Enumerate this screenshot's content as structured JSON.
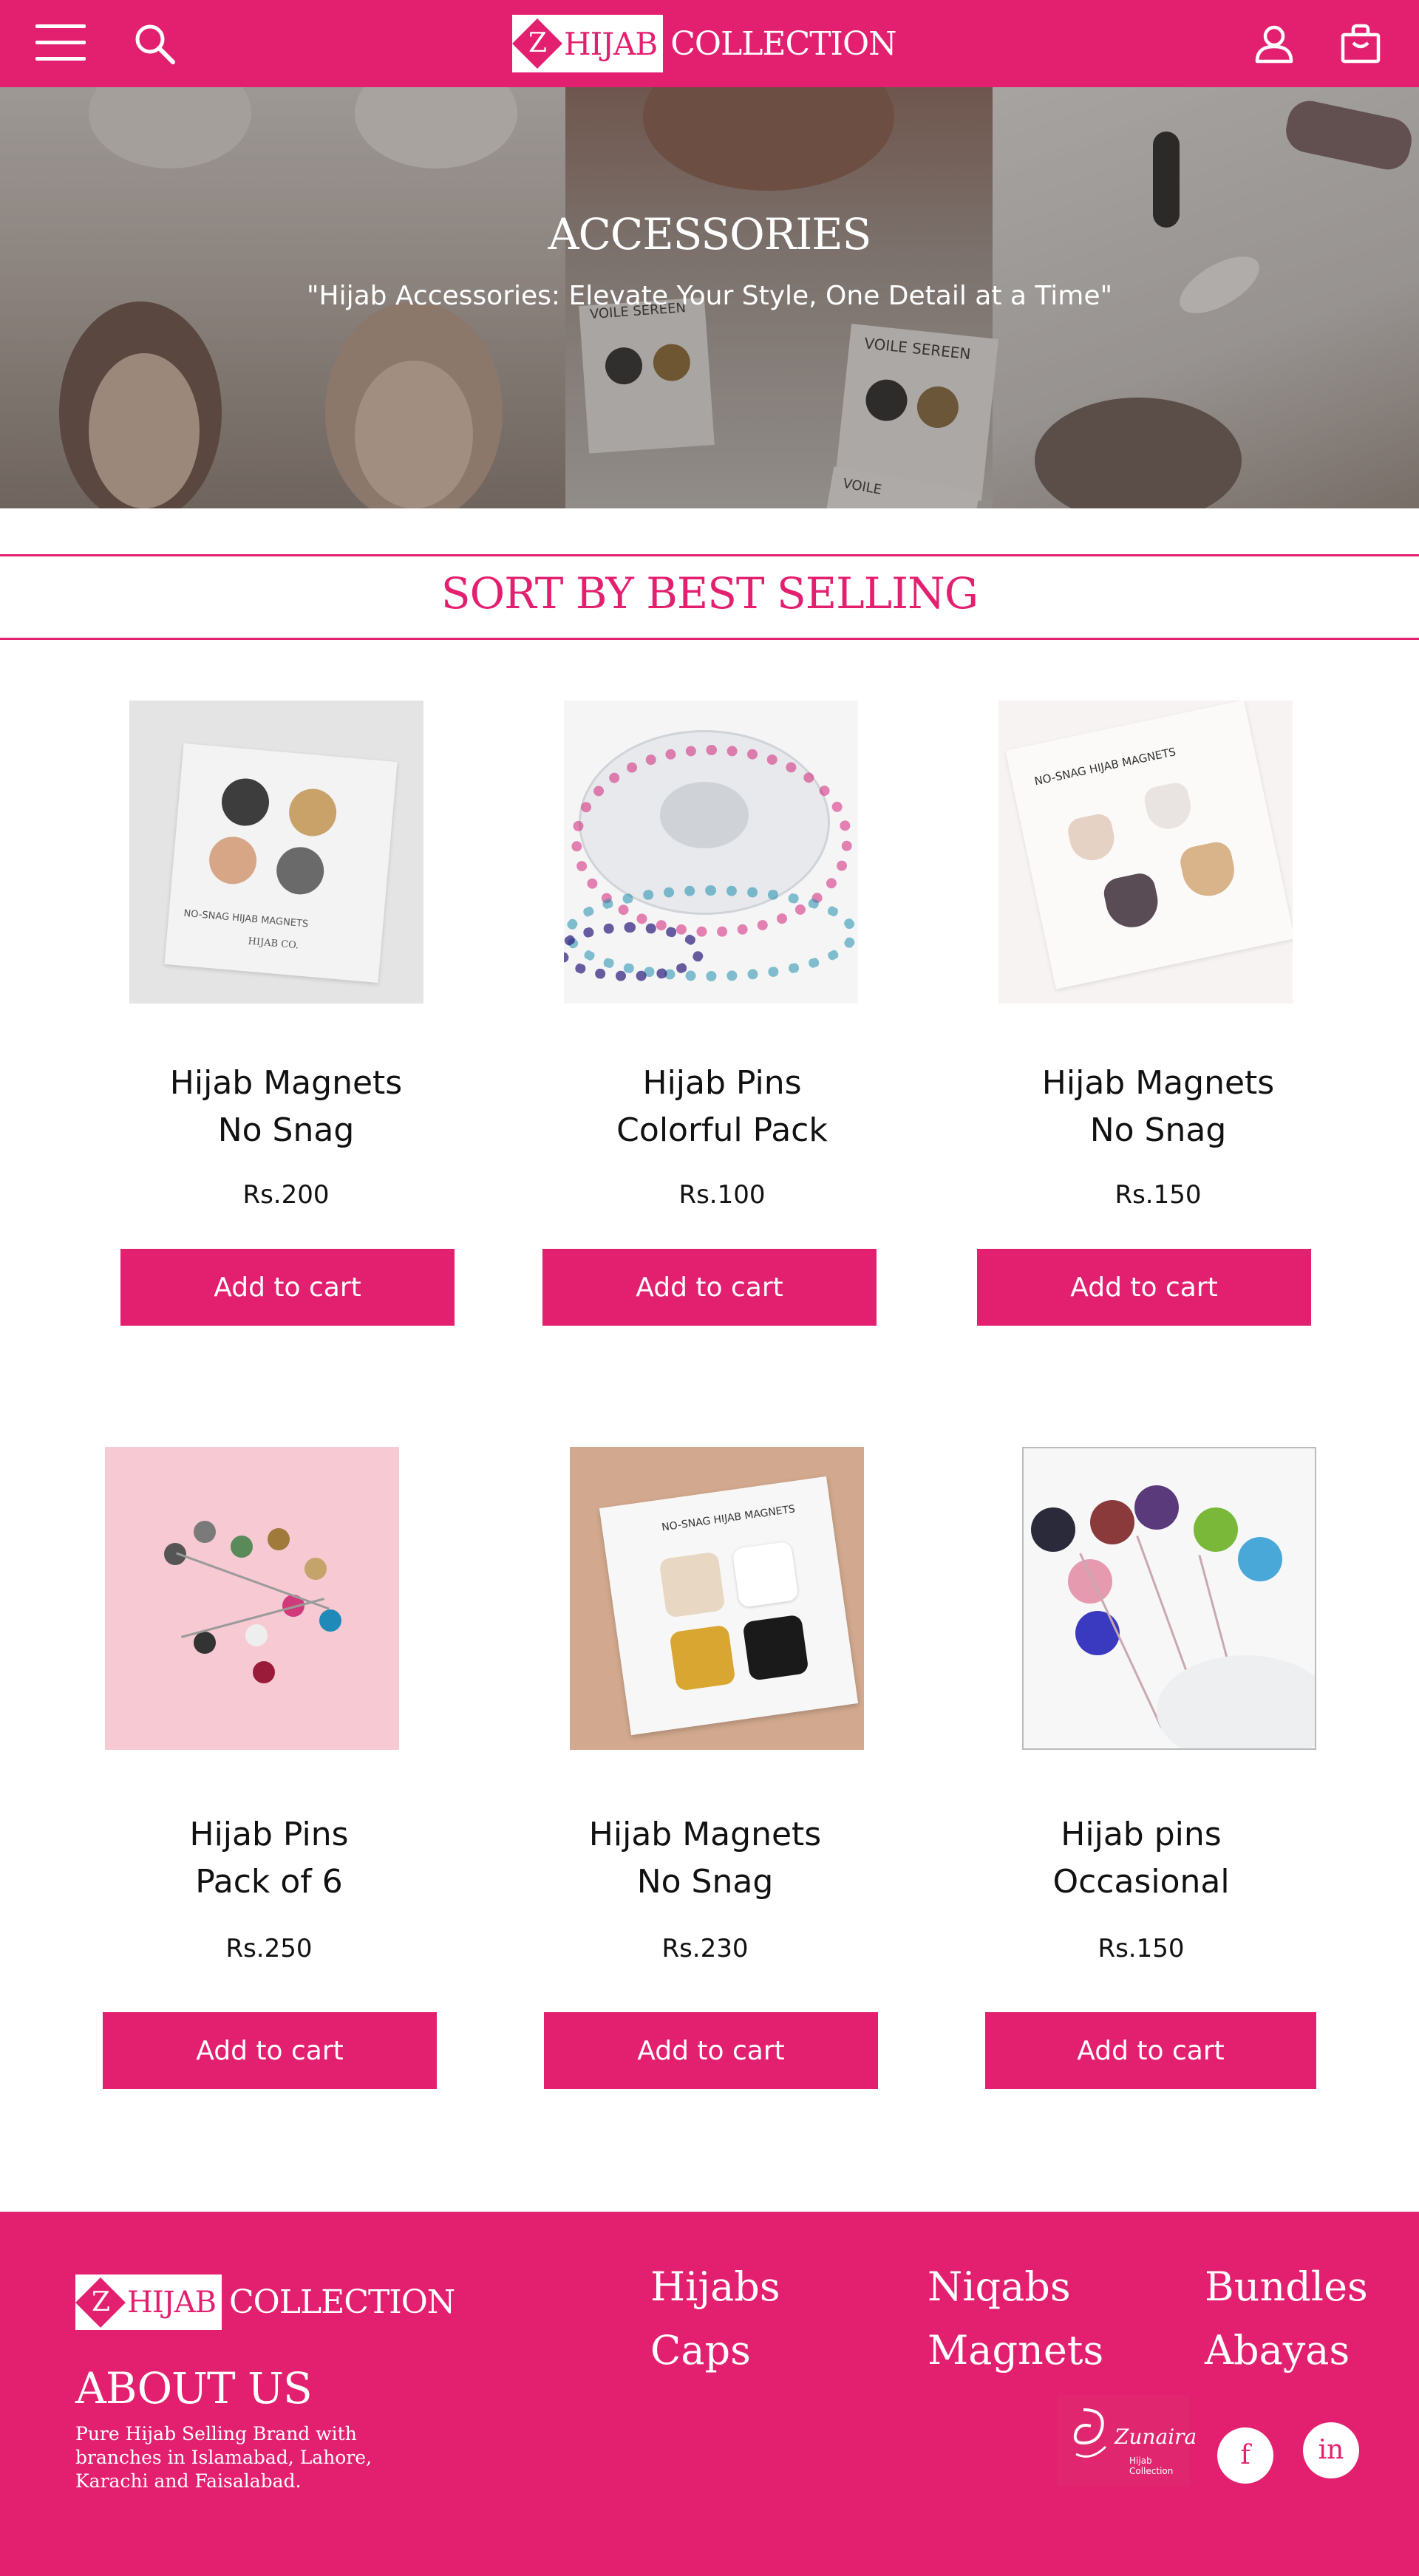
{
  "header": {
    "brand_letter": "Z",
    "brand_box_text": "HIJAB",
    "brand_text": "COLLECTION",
    "icons": [
      "menu-icon",
      "search-icon",
      "user-icon",
      "cart-icon"
    ]
  },
  "hero": {
    "title": "ACCESSORIES",
    "subtitle": "\"Hijab Accessories: Elevate Your Style, One Detail at a Time\"",
    "card_text_1": "VOILE SEREEN",
    "card_text_2": "VOILE SEREEN",
    "card_text_3": "VOILE"
  },
  "sort": {
    "label": "SORT BY BEST SELLING"
  },
  "products": [
    {
      "name": "Hijab Magnets\nNo Snag",
      "price": "Rs.200",
      "button": "Add to cart",
      "card_text": "NO-SNAG HIJAB MAGNETS",
      "card_brand": "HIJAB CO."
    },
    {
      "name": "Hijab Pins\nColorful Pack",
      "price": "Rs.100",
      "button": "Add to cart"
    },
    {
      "name": "Hijab Magnets\nNo Snag",
      "price": "Rs.150",
      "button": "Add to cart",
      "card_text": "NO-SNAG HIJAB MAGNETS"
    },
    {
      "name": "Hijab Pins\nPack of 6",
      "price": "Rs.250",
      "button": "Add to cart"
    },
    {
      "name": "Hijab Magnets\nNo Snag",
      "price": "Rs.230",
      "button": "Add to cart",
      "card_text": "NO-SNAG HIJAB MAGNETS"
    },
    {
      "name": "Hijab pins\nOccasional",
      "price": "Rs.150",
      "button": "Add to cart"
    }
  ],
  "footer": {
    "brand_letter": "Z",
    "brand_box_text": "HIJAB",
    "brand_text": "COLLECTION",
    "about_title": "ABOUT US",
    "about_text": "Pure Hijab Selling Brand with branches in Islamabad, Lahore, Karachi and Faisalabad.",
    "links": [
      "Hijabs",
      "Niqabs",
      "Bundles",
      "Caps",
      "Magnets",
      "Abayas"
    ],
    "partner_name": "Zunaira",
    "partner_tag": "Hijab Collection",
    "social": [
      "f",
      "in"
    ]
  },
  "colors": {
    "brand": "#e3206f",
    "text": "#111111",
    "white": "#ffffff"
  }
}
